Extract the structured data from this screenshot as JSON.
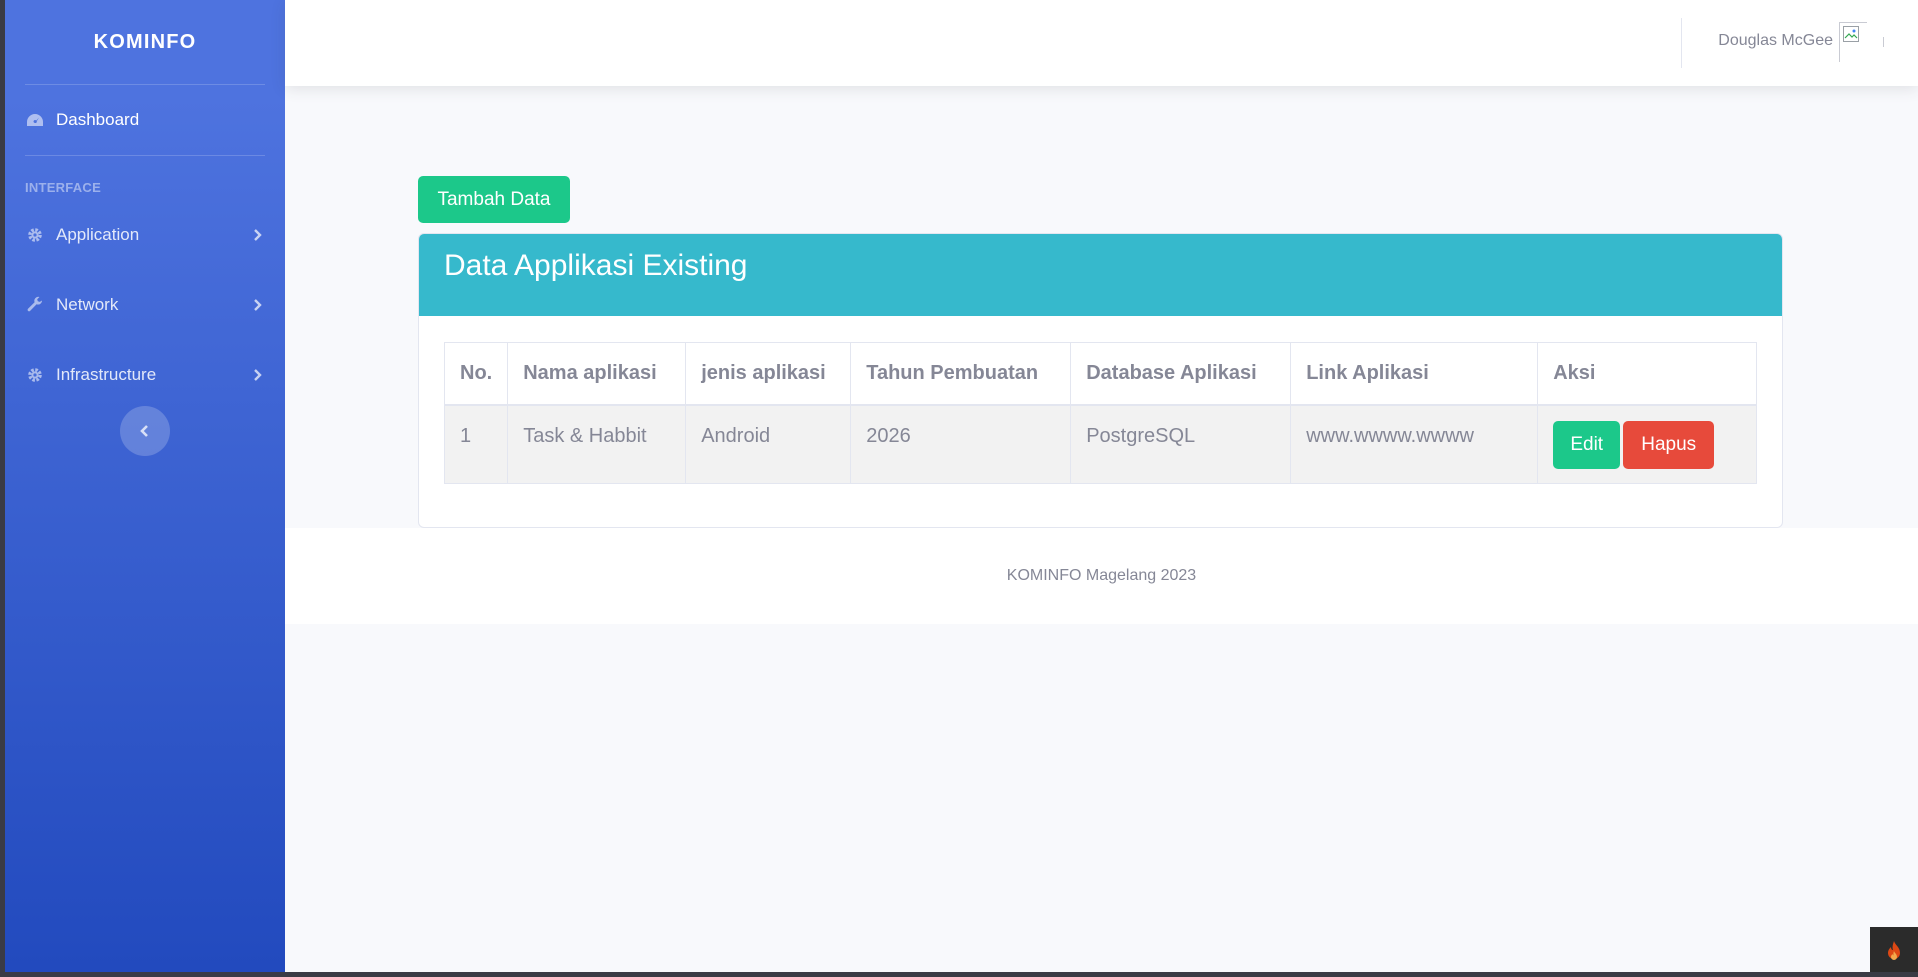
{
  "sidebar": {
    "brand": "KOMINFO",
    "dashboard": "Dashboard",
    "heading": "INTERFACE",
    "items": [
      {
        "label": "Application",
        "icon": "gear-icon"
      },
      {
        "label": "Network",
        "icon": "wrench-icon"
      },
      {
        "label": "Infrastructure",
        "icon": "gear-icon"
      }
    ]
  },
  "topbar": {
    "user_name": "Douglas McGee"
  },
  "main": {
    "add_button": "Tambah Data",
    "card_title": "Data Applikasi Existing",
    "table": {
      "headers": [
        "No.",
        "Nama aplikasi",
        "jenis aplikasi",
        "Tahun Pembuatan",
        "Database Aplikasi",
        "Link Aplikasi",
        "Aksi"
      ],
      "rows": [
        {
          "no": "1",
          "nama": "Task & Habbit",
          "jenis": "Android",
          "tahun": "2026",
          "database": "PostgreSQL",
          "link": "www.wwww.wwww",
          "edit": "Edit",
          "hapus": "Hapus"
        }
      ]
    }
  },
  "footer": {
    "text": "KOMINFO Magelang 2023"
  },
  "colors": {
    "sidebar_top": "#4e73df",
    "sidebar_bottom": "#224abe",
    "success": "#1cc88a",
    "info": "#36b9cc",
    "danger": "#e74a3b"
  }
}
